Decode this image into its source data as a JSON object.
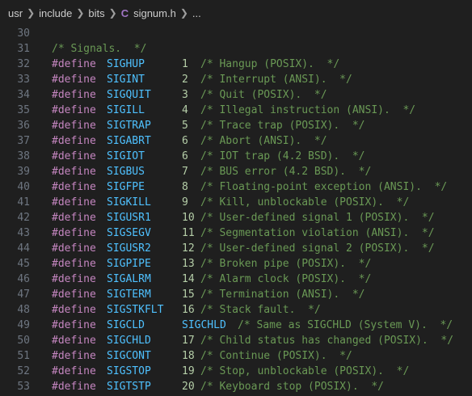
{
  "breadcrumb": {
    "items": [
      "usr",
      "include",
      "bits"
    ],
    "file_icon": "C",
    "file": "signum.h",
    "trailing": "..."
  },
  "editor": {
    "lines": [
      {
        "n": "30"
      },
      {
        "n": "31",
        "comment": "/* Signals.  */"
      },
      {
        "n": "32",
        "kw": "#define",
        "name": "SIGHUP",
        "val": "1",
        "comment": "/* Hangup (POSIX).  */"
      },
      {
        "n": "33",
        "kw": "#define",
        "name": "SIGINT",
        "val": "2",
        "comment": "/* Interrupt (ANSI).  */"
      },
      {
        "n": "34",
        "kw": "#define",
        "name": "SIGQUIT",
        "val": "3",
        "comment": "/* Quit (POSIX).  */"
      },
      {
        "n": "35",
        "kw": "#define",
        "name": "SIGILL",
        "val": "4",
        "comment": "/* Illegal instruction (ANSI).  */"
      },
      {
        "n": "36",
        "kw": "#define",
        "name": "SIGTRAP",
        "val": "5",
        "comment": "/* Trace trap (POSIX).  */"
      },
      {
        "n": "37",
        "kw": "#define",
        "name": "SIGABRT",
        "val": "6",
        "comment": "/* Abort (ANSI).  */"
      },
      {
        "n": "38",
        "kw": "#define",
        "name": "SIGIOT",
        "val": "6",
        "comment": "/* IOT trap (4.2 BSD).  */"
      },
      {
        "n": "39",
        "kw": "#define",
        "name": "SIGBUS",
        "val": "7",
        "comment": "/* BUS error (4.2 BSD).  */"
      },
      {
        "n": "40",
        "kw": "#define",
        "name": "SIGFPE",
        "val": "8",
        "comment": "/* Floating-point exception (ANSI).  */"
      },
      {
        "n": "41",
        "kw": "#define",
        "name": "SIGKILL",
        "val": "9",
        "comment": "/* Kill, unblockable (POSIX).  */"
      },
      {
        "n": "42",
        "kw": "#define",
        "name": "SIGUSR1",
        "val": "10",
        "comment": "/* User-defined signal 1 (POSIX).  */"
      },
      {
        "n": "43",
        "kw": "#define",
        "name": "SIGSEGV",
        "val": "11",
        "comment": "/* Segmentation violation (ANSI).  */"
      },
      {
        "n": "44",
        "kw": "#define",
        "name": "SIGUSR2",
        "val": "12",
        "comment": "/* User-defined signal 2 (POSIX).  */"
      },
      {
        "n": "45",
        "kw": "#define",
        "name": "SIGPIPE",
        "val": "13",
        "comment": "/* Broken pipe (POSIX).  */"
      },
      {
        "n": "46",
        "kw": "#define",
        "name": "SIGALRM",
        "val": "14",
        "comment": "/* Alarm clock (POSIX).  */"
      },
      {
        "n": "47",
        "kw": "#define",
        "name": "SIGTERM",
        "val": "15",
        "comment": "/* Termination (ANSI).  */"
      },
      {
        "n": "48",
        "kw": "#define",
        "name": "SIGSTKFLT",
        "val": "16",
        "comment": "/* Stack fault.  */"
      },
      {
        "n": "49",
        "kw": "#define",
        "name": "SIGCLD",
        "val": "SIGCHLD",
        "val_is_macro": true,
        "comment": "/* Same as SIGCHLD (System V).  */"
      },
      {
        "n": "50",
        "kw": "#define",
        "name": "SIGCHLD",
        "val": "17",
        "comment": "/* Child status has changed (POSIX).  */"
      },
      {
        "n": "51",
        "kw": "#define",
        "name": "SIGCONT",
        "val": "18",
        "comment": "/* Continue (POSIX).  */"
      },
      {
        "n": "52",
        "kw": "#define",
        "name": "SIGSTOP",
        "val": "19",
        "comment": "/* Stop, unblockable (POSIX).  */"
      },
      {
        "n": "53",
        "kw": "#define",
        "name": "SIGTSTP",
        "val": "20",
        "comment": "/* Keyboard stop (POSIX).  */"
      }
    ]
  },
  "colors": {
    "background": "#1f1f1f",
    "line_number": "#6e7681",
    "keyword": "#c586c0",
    "macro": "#4fc1ff",
    "number": "#b5cea8",
    "comment": "#6a9955"
  }
}
